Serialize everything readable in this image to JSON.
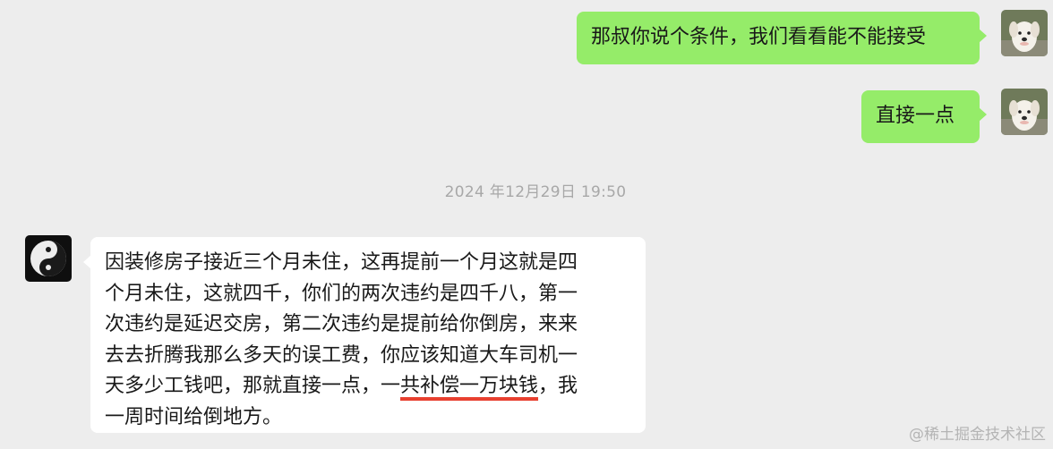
{
  "messages": {
    "out_1": {
      "text": "那叔你说个条件，我们看看能不能接受"
    },
    "out_2": {
      "text": "直接一点"
    },
    "timestamp": "2024 年12月29日 19:50",
    "in_1": {
      "lines": [
        "因装修房子接近三个月未住，这再提前一个月这就是四",
        "个月未住，这就四千，你们的两次违约是四千八，第一",
        "次违约是延迟交房，第二次违约是提前给你倒房，来来",
        "去去折腾我那么多天的误工费，你应该知道大车司机一"
      ],
      "line5_before": "天多少工钱吧，那就直接一点，一",
      "line5_highlight": "共补偿一万块钱",
      "line5_after": "，我",
      "line6": "一周时间给倒地方。",
      "highlight_color": "#e8402f"
    }
  },
  "avatars": {
    "self": "puppy-avatar",
    "other": "yin-yang-avatar"
  },
  "watermark": "@稀土掘金技术社区",
  "colors": {
    "background": "#ededed",
    "outgoing_bubble": "#95ec69",
    "incoming_bubble": "#ffffff",
    "timestamp_text": "#a8a8a8"
  }
}
